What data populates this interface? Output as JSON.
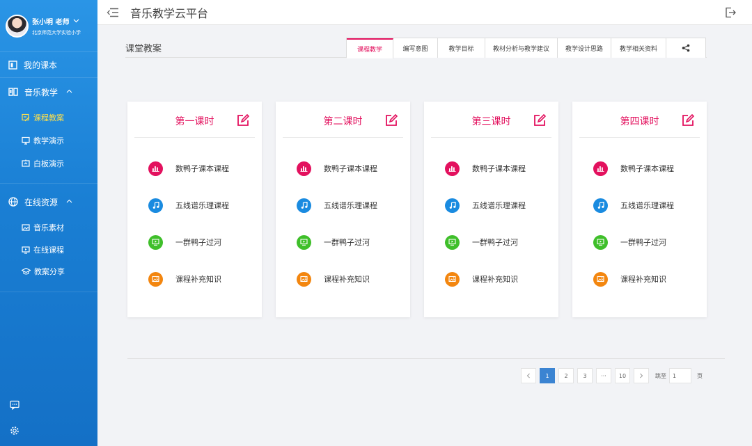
{
  "user": {
    "name": "张小明 老师",
    "school": "北京师范大学实验小学"
  },
  "sidebar": {
    "my_books": "我的课本",
    "groups": [
      {
        "label": "音乐教学",
        "items": [
          {
            "label": "课程教案",
            "active": true
          },
          {
            "label": "教学演示",
            "active": false
          },
          {
            "label": "白板演示",
            "active": false
          }
        ]
      },
      {
        "label": "在线资源",
        "items": [
          {
            "label": "音乐素材",
            "active": false
          },
          {
            "label": "在线课程",
            "active": false
          },
          {
            "label": "教案分享",
            "active": false
          }
        ]
      }
    ]
  },
  "header": {
    "title": "音乐教学云平台"
  },
  "main": {
    "section_title": "课堂教案",
    "tabs": [
      {
        "label": "课程教学",
        "active": true
      },
      {
        "label": "编写意图",
        "active": false
      },
      {
        "label": "教学目标",
        "active": false
      },
      {
        "label": "教材分析与教学建议",
        "active": false
      },
      {
        "label": "教学设计思路",
        "active": false
      },
      {
        "label": "教学相关资料",
        "active": false
      }
    ],
    "cards": [
      {
        "title": "第一课时",
        "items": [
          "数鸭子课本课程",
          "五线谱乐理课程",
          "一群鸭子过河",
          "课程补充知识"
        ]
      },
      {
        "title": "第二课时",
        "items": [
          "数鸭子课本课程",
          "五线谱乐理课程",
          "一群鸭子过河",
          "课程补充知识"
        ]
      },
      {
        "title": "第三课时",
        "items": [
          "数鸭子课本课程",
          "五线谱乐理课程",
          "一群鸭子过河",
          "课程补充知识"
        ]
      },
      {
        "title": "第四课时",
        "items": [
          "数鸭子课本课程",
          "五线谱乐理课程",
          "一群鸭子过河",
          "课程补充知识"
        ]
      }
    ],
    "item_icons": [
      {
        "name": "bar-chart-icon",
        "color": "#e3115e"
      },
      {
        "name": "music-note-icon",
        "color": "#1a8be0"
      },
      {
        "name": "monitor-icon",
        "color": "#3fbf2a"
      },
      {
        "name": "image-icon",
        "color": "#f3860f"
      }
    ]
  },
  "pagination": {
    "pages": [
      "1",
      "2",
      "3",
      "···",
      "10"
    ],
    "current": "1",
    "jump_label": "跳至",
    "jump_value": "1",
    "page_unit": "页"
  },
  "colors": {
    "accent": "#e3115e",
    "sidebar": "#1a7fd4",
    "page_active": "#3b84d2"
  }
}
